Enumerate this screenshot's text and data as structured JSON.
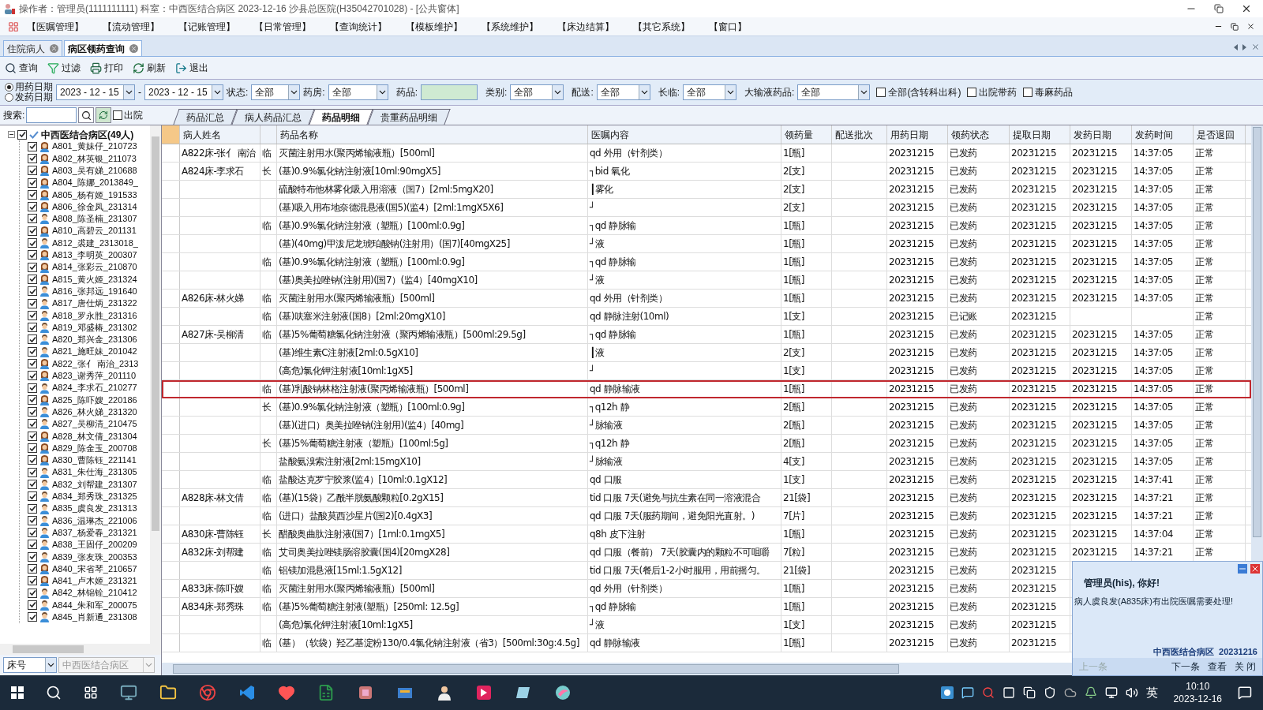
{
  "window": {
    "title": "操作者：管理员(1111111111)  科室：中西医结合病区  2023-12-16  沙县总医院(H35042701028) - [公共窗体]"
  },
  "menu": [
    "【医嘱管理】",
    "【流动管理】",
    "【记账管理】",
    "【日常管理】",
    "【查询统计】",
    "【模板维护】",
    "【系统维护】",
    "【床边结算】",
    "【其它系统】",
    "【窗口】"
  ],
  "doc_tabs": [
    {
      "label": "住院病人",
      "selected": false
    },
    {
      "label": "病区领药查询",
      "selected": true
    }
  ],
  "toolbar": [
    {
      "kind": "search",
      "label": "查询"
    },
    {
      "kind": "filter",
      "label": "过滤"
    },
    {
      "kind": "print",
      "label": "打印"
    },
    {
      "kind": "refresh",
      "label": "刷新"
    },
    {
      "kind": "exit",
      "label": "退出"
    }
  ],
  "filters": {
    "date_modes": [
      {
        "label": "用药日期",
        "selected": true
      },
      {
        "label": "发药日期",
        "selected": false
      }
    ],
    "date_from": "2023 - 12 - 15",
    "date_sep": "-",
    "date_to": "2023 - 12 - 15",
    "combos": [
      {
        "label": "状态:",
        "value": "全部"
      },
      {
        "label": "药房:",
        "value": "全部"
      }
    ],
    "drug_label": "药品:",
    "combos2": [
      {
        "label": "类别:",
        "value": "全部"
      },
      {
        "label": "配送:",
        "value": "全部"
      },
      {
        "label": "长临:",
        "value": "全部"
      },
      {
        "label": "大输液药品:",
        "value": "全部"
      }
    ],
    "checks": [
      {
        "label": "全部(含转科出科)",
        "checked": false
      },
      {
        "label": "出院带药",
        "checked": false
      },
      {
        "label": "毒麻药品",
        "checked": false
      }
    ]
  },
  "search": {
    "label": "搜索:",
    "discharged": {
      "label": "出院",
      "checked": false
    }
  },
  "view_tabs": [
    {
      "label": "药品汇总",
      "selected": false
    },
    {
      "label": "病人药品汇总",
      "selected": false
    },
    {
      "label": "药品明细",
      "selected": true
    },
    {
      "label": "贵重药品明细",
      "selected": false
    }
  ],
  "tree": {
    "root": {
      "label": "中西医结合病区(49人)",
      "checked": true,
      "expanded": true
    },
    "patients": [
      {
        "label": "A801_黄妹仔_210723",
        "kind": "female",
        "checked": true
      },
      {
        "label": "A802_林英银_211073",
        "kind": "female",
        "checked": true
      },
      {
        "label": "A803_吴有娣_210688",
        "kind": "female",
        "checked": true
      },
      {
        "label": "A804_陈娜_2013849_",
        "kind": "female",
        "checked": true
      },
      {
        "label": "A805_杨有姬_191533",
        "kind": "female",
        "checked": true
      },
      {
        "label": "A806_徐金凤_231314",
        "kind": "female",
        "checked": true
      },
      {
        "label": "A808_陈圣楠_231307",
        "kind": "male",
        "checked": true
      },
      {
        "label": "A810_高碧云_201131",
        "kind": "female",
        "checked": true
      },
      {
        "label": "A812_裘建_2313018_",
        "kind": "male",
        "checked": true
      },
      {
        "label": "A813_李明英_200307",
        "kind": "female",
        "checked": true
      },
      {
        "label": "A814_张彩云_210870",
        "kind": "female",
        "checked": true
      },
      {
        "label": "A815_黄火姬_231324",
        "kind": "female",
        "checked": true
      },
      {
        "label": "A816_张邦远_191640",
        "kind": "male",
        "checked": true
      },
      {
        "label": "A817_唐仕炳_231322",
        "kind": "male",
        "checked": true
      },
      {
        "label": "A818_罗永胜_231316",
        "kind": "male",
        "checked": true
      },
      {
        "label": "A819_邓盛椿_231302",
        "kind": "male",
        "checked": true
      },
      {
        "label": "A820_郑兴金_231306",
        "kind": "male",
        "checked": true
      },
      {
        "label": "A821_施旺妹_201042",
        "kind": "male",
        "checked": true
      },
      {
        "label": "A822_张亻 南治_2313",
        "kind": "female",
        "checked": true
      },
      {
        "label": "A823_谢秀萍_201110",
        "kind": "female",
        "checked": true
      },
      {
        "label": "A824_李求石_210277",
        "kind": "male",
        "checked": true
      },
      {
        "label": "A825_陈吓嫂_220186",
        "kind": "female",
        "checked": true
      },
      {
        "label": "A826_林火娣_231320",
        "kind": "male",
        "checked": true
      },
      {
        "label": "A827_吴柳清_210475",
        "kind": "male",
        "checked": true
      },
      {
        "label": "A828_林文倩_231304",
        "kind": "female",
        "checked": true
      },
      {
        "label": "A829_陈金玉_200708",
        "kind": "female",
        "checked": true
      },
      {
        "label": "A830_曹陈钰_221141",
        "kind": "female",
        "checked": true
      },
      {
        "label": "A831_朱仕海_231305",
        "kind": "male",
        "checked": true
      },
      {
        "label": "A832_刘帮建_231307",
        "kind": "male",
        "checked": true
      },
      {
        "label": "A834_郑秀珠_231325",
        "kind": "male",
        "checked": true
      },
      {
        "label": "A835_虞良发_231313",
        "kind": "male",
        "checked": true
      },
      {
        "label": "A836_温琳杰_221006",
        "kind": "male",
        "checked": true
      },
      {
        "label": "A837_杨爱春_231321",
        "kind": "male",
        "checked": true
      },
      {
        "label": "A838_王固仔_200209",
        "kind": "male",
        "checked": true
      },
      {
        "label": "A839_张友珠_200353",
        "kind": "male",
        "checked": true
      },
      {
        "label": "A840_宋省琴_210657",
        "kind": "female",
        "checked": true
      },
      {
        "label": "A841_卢木姬_231321",
        "kind": "female",
        "checked": true
      },
      {
        "label": "A842_林锦铨_210412",
        "kind": "male",
        "checked": true
      },
      {
        "label": "A844_朱和军_200075",
        "kind": "male",
        "checked": true
      },
      {
        "label": "A845_肖新通_231308",
        "kind": "male",
        "checked": true
      }
    ]
  },
  "bottom": {
    "sort": "床号",
    "ward": "中西医结合病区"
  },
  "table": {
    "columns": [
      "病人姓名",
      "",
      "药品名称",
      "医嘱内容",
      "领药量",
      "配送批次",
      "用药日期",
      "领药状态",
      "提取日期",
      "发药日期",
      "发药时间",
      "是否退回"
    ],
    "rows": [
      {
        "patient": "A822床-张亻 南治",
        "type": "临",
        "drug": "灭菌注射用水(聚丙烯输液瓶）[500ml]",
        "order": "qd 外用（针剂类）",
        "qty": "1[瓶]",
        "use_date": "20231215",
        "status": "已发药",
        "fetch_date": "20231215",
        "issue_date": "20231215",
        "issue_time": "14:37:05",
        "returned": "正常",
        "highlighted": false
      },
      {
        "patient": "A824床-李求石",
        "type": "长",
        "drug": "(基)0.9%氯化钠注射液[10ml:90mgX5]",
        "order": "┐bid 氧化",
        "qty": "2[支]",
        "use_date": "20231215",
        "status": "已发药",
        "fetch_date": "20231215",
        "issue_date": "20231215",
        "issue_time": "14:37:05",
        "returned": "正常",
        "highlighted": false
      },
      {
        "drug": "硫酸特布他林雾化吸入用溶液（国7）[2ml:5mgX20]",
        "order": "┃雾化",
        "qty": "2[支]",
        "use_date": "20231215",
        "status": "已发药",
        "fetch_date": "20231215",
        "issue_date": "20231215",
        "issue_time": "14:37:05",
        "returned": "正常",
        "highlighted": false
      },
      {
        "drug": "(基)吸入用布地奈德混悬液(国5)(监4）[2ml:1mgX5X6]",
        "order": "┘",
        "qty": "2[支]",
        "use_date": "20231215",
        "status": "已发药",
        "fetch_date": "20231215",
        "issue_date": "20231215",
        "issue_time": "14:37:05",
        "returned": "正常",
        "highlighted": false
      },
      {
        "type": "临",
        "drug": "(基)0.9%氯化钠注射液（塑瓶）[100ml:0.9g]",
        "order": "┐qd 静脉输",
        "qty": "1[瓶]",
        "use_date": "20231215",
        "status": "已发药",
        "fetch_date": "20231215",
        "issue_date": "20231215",
        "issue_time": "14:37:05",
        "returned": "正常",
        "highlighted": false
      },
      {
        "drug": "(基)(40mg)甲泼尼龙琥珀酸钠(注射用）(国7)[40mgX25]",
        "order": "┘液",
        "qty": "1[瓶]",
        "use_date": "20231215",
        "status": "已发药",
        "fetch_date": "20231215",
        "issue_date": "20231215",
        "issue_time": "14:37:05",
        "returned": "正常",
        "highlighted": false
      },
      {
        "type": "临",
        "drug": "(基)0.9%氯化钠注射液（塑瓶）[100ml:0.9g]",
        "order": "┐qd 静脉输",
        "qty": "1[瓶]",
        "use_date": "20231215",
        "status": "已发药",
        "fetch_date": "20231215",
        "issue_date": "20231215",
        "issue_time": "14:37:05",
        "returned": "正常",
        "highlighted": false
      },
      {
        "drug": "(基)奥美拉唑钠(注射用)(国7）(监4）[40mgX10]",
        "order": "┘液",
        "qty": "1[瓶]",
        "use_date": "20231215",
        "status": "已发药",
        "fetch_date": "20231215",
        "issue_date": "20231215",
        "issue_time": "14:37:05",
        "returned": "正常",
        "highlighted": false
      },
      {
        "patient": "A826床-林火娣",
        "type": "临",
        "drug": "灭菌注射用水(聚丙烯输液瓶）[500ml]",
        "order": "qd 外用（针剂类）",
        "qty": "1[瓶]",
        "use_date": "20231215",
        "status": "已发药",
        "fetch_date": "20231215",
        "issue_date": "20231215",
        "issue_time": "14:37:05",
        "returned": "正常",
        "highlighted": false
      },
      {
        "type": "临",
        "drug": "(基)呋塞米注射液(国8）[2ml:20mgX10]",
        "order": "qd 静脉注射(10ml)",
        "qty": "1[支]",
        "use_date": "20231215",
        "status": "已记账",
        "fetch_date": "20231215",
        "returned": "正常",
        "highlighted": false
      },
      {
        "patient": "A827床-吴柳清",
        "type": "临",
        "drug": "(基)5%葡萄糖氯化钠注射液（聚丙烯输液瓶）[500ml:29.5g]",
        "order": "┐qd 静脉输",
        "qty": "1[瓶]",
        "use_date": "20231215",
        "status": "已发药",
        "fetch_date": "20231215",
        "issue_date": "20231215",
        "issue_time": "14:37:05",
        "returned": "正常",
        "highlighted": false
      },
      {
        "drug": "(基)维生素C注射液[2ml:0.5gX10]",
        "order": "┃液",
        "qty": "2[支]",
        "use_date": "20231215",
        "status": "已发药",
        "fetch_date": "20231215",
        "issue_date": "20231215",
        "issue_time": "14:37:05",
        "returned": "正常",
        "highlighted": false
      },
      {
        "drug": "(高危)氯化钾注射液[10ml:1gX5]",
        "order": "┘",
        "qty": "1[支]",
        "use_date": "20231215",
        "status": "已发药",
        "fetch_date": "20231215",
        "issue_date": "20231215",
        "issue_time": "14:37:05",
        "returned": "正常",
        "highlighted": false
      },
      {
        "type": "临",
        "drug": "(基)乳酸钠林格注射液(聚丙烯输液瓶）[500ml]",
        "order": "qd 静脉输液",
        "qty": "1[瓶]",
        "use_date": "20231215",
        "status": "已发药",
        "fetch_date": "20231215",
        "issue_date": "20231215",
        "issue_time": "14:37:05",
        "returned": "正常",
        "highlighted": true
      },
      {
        "type": "长",
        "drug": "(基)0.9%氯化钠注射液（塑瓶）[100ml:0.9g]",
        "order": "┐q12h 静",
        "qty": "2[瓶]",
        "use_date": "20231215",
        "status": "已发药",
        "fetch_date": "20231215",
        "issue_date": "20231215",
        "issue_time": "14:37:05",
        "returned": "正常",
        "highlighted": false
      },
      {
        "drug": "(基)(进口）奥美拉唑钠(注射用)(监4）[40mg]",
        "order": "┘脉输液",
        "qty": "2[瓶]",
        "use_date": "20231215",
        "status": "已发药",
        "fetch_date": "20231215",
        "issue_date": "20231215",
        "issue_time": "14:37:05",
        "returned": "正常",
        "highlighted": false
      },
      {
        "type": "长",
        "drug": "(基)5%葡萄糖注射液（塑瓶）[100ml:5g]",
        "order": "┐q12h 静",
        "qty": "2[瓶]",
        "use_date": "20231215",
        "status": "已发药",
        "fetch_date": "20231215",
        "issue_date": "20231215",
        "issue_time": "14:37:05",
        "returned": "正常",
        "highlighted": false
      },
      {
        "drug": "盐酸氨溴索注射液[2ml:15mgX10]",
        "order": "┘脉输液",
        "qty": "4[支]",
        "use_date": "20231215",
        "status": "已发药",
        "fetch_date": "20231215",
        "issue_date": "20231215",
        "issue_time": "14:37:05",
        "returned": "正常",
        "highlighted": false
      },
      {
        "type": "临",
        "drug": "盐酸达克罗宁胶浆(监4）[10ml:0.1gX12]",
        "order": "qd 口服",
        "qty": "1[支]",
        "use_date": "20231215",
        "status": "已发药",
        "fetch_date": "20231215",
        "issue_date": "20231215",
        "issue_time": "14:37:41",
        "returned": "正常",
        "highlighted": false
      },
      {
        "patient": "A828床-林文倩",
        "type": "临",
        "drug": "(基)(15袋）乙酰半胱氨酸颗粒[0.2gX15]",
        "order": "tid 口服 7天(避免与抗生素在同一溶液混合",
        "qty": "21[袋]",
        "use_date": "20231215",
        "status": "已发药",
        "fetch_date": "20231215",
        "issue_date": "20231215",
        "issue_time": "14:37:21",
        "returned": "正常",
        "highlighted": false
      },
      {
        "type": "临",
        "drug": "(进口）盐酸莫西沙星片(国2)[0.4gX3]",
        "order": "qd 口服 7天(服药期间，避免阳光直射。)",
        "qty": "7[片]",
        "use_date": "20231215",
        "status": "已发药",
        "fetch_date": "20231215",
        "issue_date": "20231215",
        "issue_time": "14:37:21",
        "returned": "正常",
        "highlighted": false
      },
      {
        "patient": "A830床-曹陈钰",
        "type": "长",
        "drug": "醋酸奥曲肽注射液(国7）[1ml:0.1mgX5]",
        "order": "q8h 皮下注射",
        "qty": "1[瓶]",
        "use_date": "20231215",
        "status": "已发药",
        "fetch_date": "20231215",
        "issue_date": "20231215",
        "issue_time": "14:37:04",
        "returned": "正常",
        "highlighted": false
      },
      {
        "patient": "A832床-刘帮建",
        "type": "临",
        "drug": "艾司奥美拉唑镁肠溶胶囊(国4)[20mgX28]",
        "order": "qd 口服（餐前） 7天(胶囊内的颗粒不可咀嚼",
        "qty": "7[粒]",
        "use_date": "20231215",
        "status": "已发药",
        "fetch_date": "20231215",
        "issue_date": "20231215",
        "issue_time": "14:37:21",
        "returned": "正常",
        "highlighted": false
      },
      {
        "type": "临",
        "drug": "铝镁加混悬液[15ml:1.5gX12]",
        "order": "tid 口服 7天(餐后1-2小时服用，用前摇匀。",
        "qty": "21[袋]",
        "use_date": "20231215",
        "status": "已发药",
        "fetch_date": "20231215",
        "highlighted": false
      },
      {
        "patient": "A833床-陈吓嫂",
        "type": "临",
        "drug": "灭菌注射用水(聚丙烯输液瓶）[500ml]",
        "order": "qd 外用（针剂类）",
        "qty": "1[瓶]",
        "use_date": "20231215",
        "status": "已发药",
        "fetch_date": "20231215",
        "highlighted": false
      },
      {
        "patient": "A834床-郑秀珠",
        "type": "临",
        "drug": "(基)5%葡萄糖注射液(塑瓶）[250ml: 12.5g]",
        "order": "┐qd 静脉输",
        "qty": "1[瓶]",
        "use_date": "20231215",
        "status": "已发药",
        "fetch_date": "20231215",
        "highlighted": false
      },
      {
        "drug": "(高危)氯化钾注射液[10ml:1gX5]",
        "order": "┘液",
        "qty": "1[支]",
        "use_date": "20231215",
        "status": "已发药",
        "fetch_date": "20231215",
        "highlighted": false
      },
      {
        "type": "临",
        "drug": "(基）（软袋）羟乙基淀粉130/0.4氯化钠注射液（省3）[500ml:30g:4.5g]",
        "order": "qd 静脉输液",
        "qty": "1[瓶]",
        "use_date": "20231215",
        "status": "已发药",
        "fetch_date": "20231215",
        "highlighted": false
      }
    ]
  },
  "popup": {
    "title": "管理员(his), 你好!",
    "message": "病人虞良发(A835床)有出院医嘱需要处理!",
    "footer": "中西医结合病区  20231216",
    "links": [
      {
        "label": "上一条",
        "disabled": true
      },
      {
        "label": "下一条",
        "disabled": false
      },
      {
        "label": "查看",
        "disabled": false
      },
      {
        "label": "关 闭",
        "disabled": false
      }
    ]
  },
  "taskbar": {
    "ime": "英",
    "time": "10:10",
    "date": "2023-12-16"
  }
}
